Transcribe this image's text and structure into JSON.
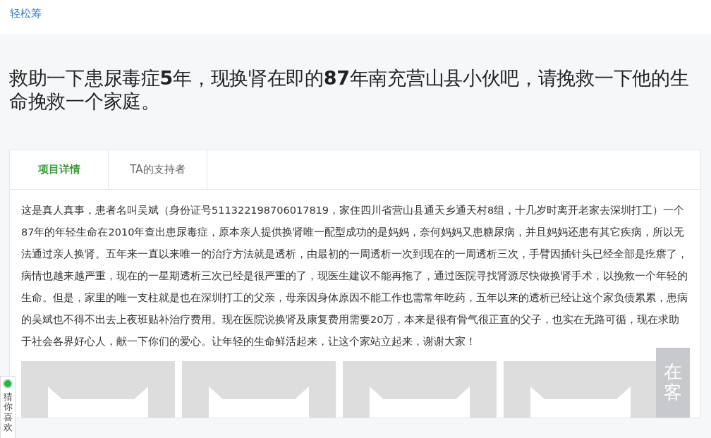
{
  "header": {
    "brand": "轻松筹"
  },
  "title": "救助一下患尿毒症**5**年，现换肾在即的**87**年南充营山县小伙吧，请挽救一下他的生命挽救一个家庭。",
  "tabs": [
    {
      "label": "项目详情",
      "selected": true
    },
    {
      "label": "TA的支持者",
      "selected": false
    }
  ],
  "story": "这是真人真事，患者名叫吴斌（身份证号511322198706017819，家住四川省营山县通天乡通天村8组，十几岁时离开老家去深圳打工）一个87年的年轻生命在2010年查出患尿毒症，原本亲人提供换肾唯一配型成功的是妈妈，奈何妈妈又患糖尿病，并且妈妈还患有其它疾病，所以无法通过亲人换肾。五年来一直以来唯一的治疗方法就是透析，由最初的一周透析一次到现在的一周透析三次，手臂因插针头已经全部是疙瘩了，病情也越来越严重，现在的一星期透析三次已经是很严重的了，现医生建议不能再拖了，通过医院寻找肾源尽快做换肾手术，以挽救一个年轻的生命。但是，家里的唯一支柱就是也在深圳打工的父亲，母亲因身体原因不能工作也需常年吃药，五年以来的透析已经让这个家负债累累，患病的吴斌也不得不出去上夜班贴补治疗费用。现在医院说换肾及康复费用需要20万，本来是很有骨气很正直的父子，也实在无路可循，现在求助于社会各界好心人，献一下你们的爱心。让年轻的生命鲜活起来，让这个家站立起来，谢谢大家！",
  "side_tab": {
    "label": "猜你喜欢"
  },
  "float_tab": {
    "label": "在客"
  }
}
